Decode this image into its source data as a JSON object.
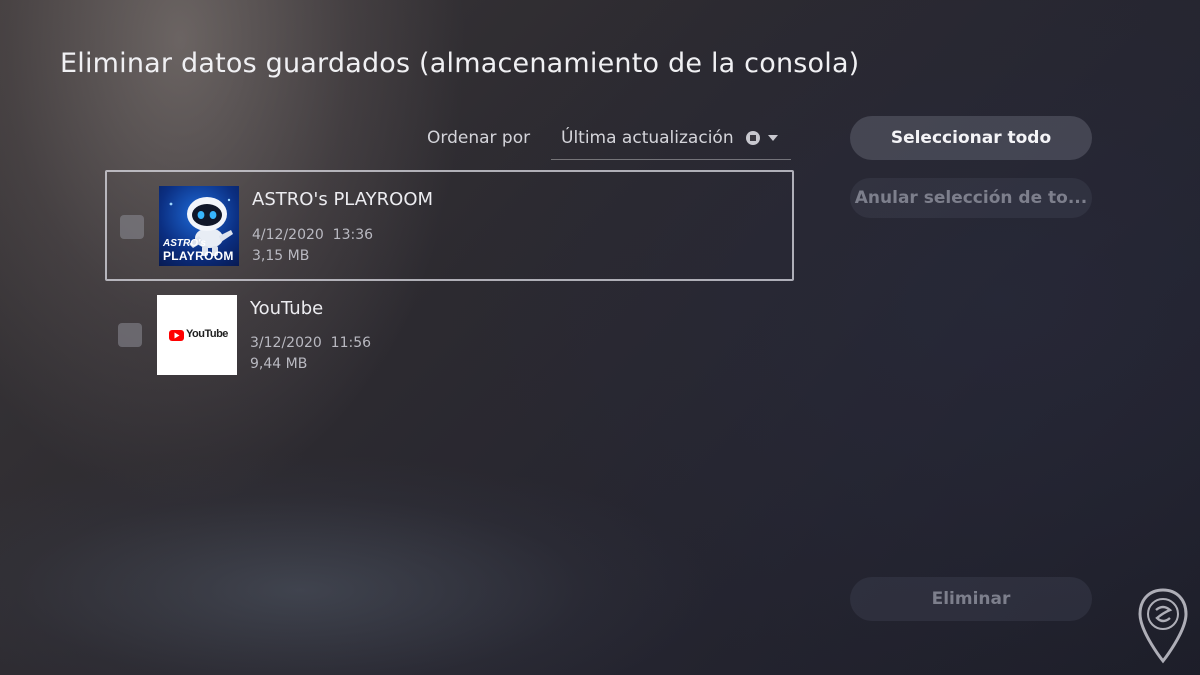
{
  "page": {
    "title": "Eliminar datos guardados (almacenamiento de la consola)"
  },
  "sort": {
    "label": "Ordenar por",
    "value": "Última actualización",
    "icon": "square-button-icon"
  },
  "items": [
    {
      "name": "ASTRO's PLAYROOM",
      "date": "4/12/2020  13:36",
      "size": "3,15 MB",
      "thumb_text_top": "ASTRO's",
      "thumb_text_bottom": "PLAYROOM",
      "checked": false,
      "focused": true
    },
    {
      "name": "YouTube",
      "date": "3/12/2020  11:56",
      "size": "9,44 MB",
      "thumb_text": "YouTube",
      "checked": false,
      "focused": false
    }
  ],
  "actions": {
    "select_all": "Seleccionar todo",
    "deselect_all": "Anular selección de to...",
    "delete": "Eliminar"
  },
  "colors": {
    "youtube_red": "#ff0000",
    "astro_blue": "#1e6ad8"
  }
}
